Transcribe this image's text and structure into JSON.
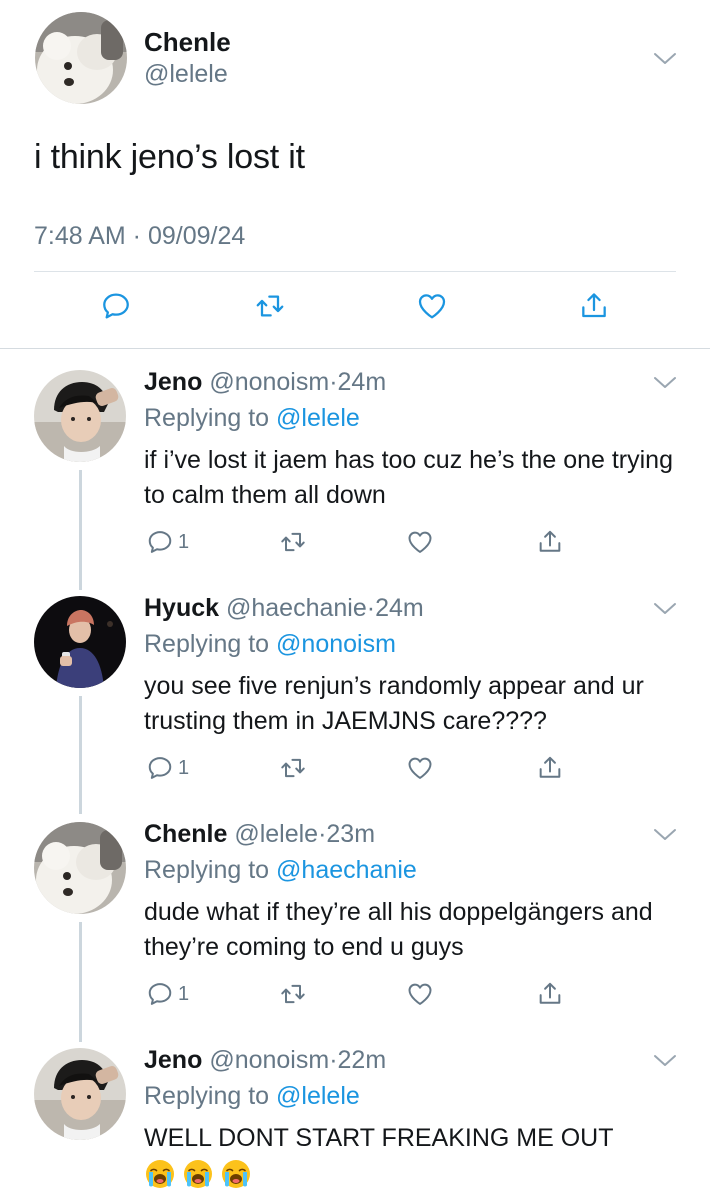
{
  "main_tweet": {
    "name": "Chenle",
    "handle": "@lelele",
    "text": "i think jeno’s lost it",
    "meta": "7:48 AM · 09/09/24"
  },
  "replies": [
    {
      "name": "Jeno",
      "handle": "@nonoism",
      "dot": "·",
      "time": "24m",
      "replying_prefix": "Replying to ",
      "replying_to": "@lelele",
      "text": "if i’ve lost it jaem has too cuz he’s the one trying to calm them all down",
      "reply_count": "1"
    },
    {
      "name": "Hyuck",
      "handle": "@haechanie",
      "dot": "·",
      "time": "24m",
      "replying_prefix": "Replying to ",
      "replying_to": "@nonoism",
      "text": "you see five renjun’s randomly appear and ur trusting them in JAEMJNS care????",
      "reply_count": "1"
    },
    {
      "name": "Chenle",
      "handle": "@lelele",
      "dot": "·",
      "time": "23m",
      "replying_prefix": "Replying to ",
      "replying_to": "@haechanie",
      "text": "dude what if they’re all his doppelgängers and they’re coming to end u guys",
      "reply_count": "1"
    },
    {
      "name": "Jeno",
      "handle": "@nonoism",
      "dot": "·",
      "time": "22m",
      "replying_prefix": "Replying to ",
      "replying_to": "@lelele",
      "text": "WELL DONT START FREAKING ME OUT",
      "emojis": [
        "loudly-crying-face",
        "loudly-crying-face",
        "loudly-crying-face"
      ]
    }
  ],
  "colors": {
    "text": "#14171a",
    "secondary": "#657786",
    "link": "#1b95e0",
    "icon": "#1b95e0",
    "divider": "#dde3e8",
    "thread_line": "#ccd6dd"
  }
}
